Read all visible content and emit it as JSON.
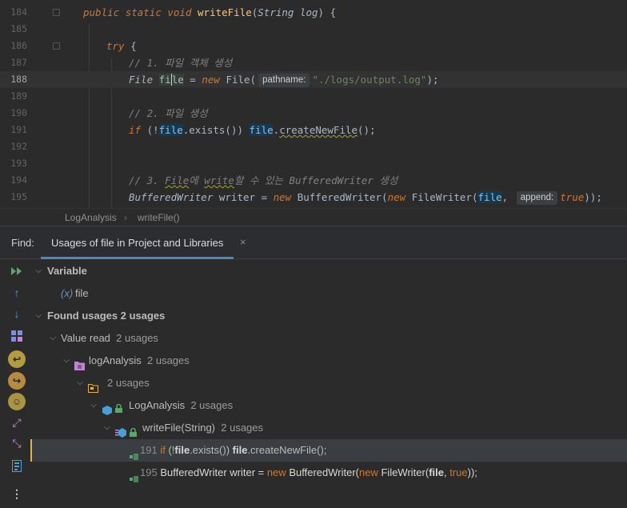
{
  "editor": {
    "lines": [
      {
        "num": "184"
      },
      {
        "num": "185"
      },
      {
        "num": "186"
      },
      {
        "num": "187"
      },
      {
        "num": "188"
      },
      {
        "num": "189"
      },
      {
        "num": "190"
      },
      {
        "num": "191"
      },
      {
        "num": "192"
      },
      {
        "num": "193"
      },
      {
        "num": "194"
      },
      {
        "num": "195"
      }
    ],
    "l184": {
      "public": "public",
      "static": "static",
      "void": "void",
      "name": "writeFile",
      "open": "(",
      "type": "String",
      "param": "log",
      "close": ") {"
    },
    "l186": {
      "try": "try",
      "brace": " {"
    },
    "l187": {
      "comment": "// 1. 파일 객체 생성"
    },
    "l188": {
      "type": "File",
      "var_a": "fi",
      "var_b": "le",
      "eq": " = ",
      "new": "new",
      "ctor": " File(",
      "hint": "pathname:",
      "str": "\"./logs/output.log\"",
      "end": ");"
    },
    "l190": {
      "comment": "// 2. 파일 생성"
    },
    "l191": {
      "if": "if",
      "open": " (!",
      "file1": "file",
      "exists": ".exists()) ",
      "file2": "file",
      "dot": ".",
      "method": "createNewFile",
      "end": "();"
    },
    "l194": {
      "c1": "// 3. ",
      "c2": "File",
      "c3": "에 ",
      "c4": "write",
      "c5": "할 수 있는 BufferedWriter 생성"
    },
    "l195": {
      "type": "BufferedWriter",
      "var": " writer",
      "eq": " = ",
      "new": "new",
      "ctor": " BufferedWriter(",
      "new2": "new",
      "ctor2": " FileWriter(",
      "file": "file",
      "comma": ", ",
      "hint": "append:",
      "true": "true",
      "end": "));"
    }
  },
  "breadcrumb": {
    "class_name": "LogAnalysis",
    "method_name": "writeFile()"
  },
  "find": {
    "label": "Find:",
    "tab_title": "Usages of file in Project and Libraries",
    "tab_close": "×",
    "tree": {
      "variable": "Variable",
      "var_prefix": "(x)",
      "var_name": "file",
      "found": "Found usages",
      "found_count": "2 usages",
      "value_read": "Value read",
      "value_read_count": "2 usages",
      "package": "logAnalysis",
      "package_count": "2 usages",
      "dir_count": "2 usages",
      "class": "LogAnalysis",
      "class_count": "2 usages",
      "method": "writeFile(String)",
      "method_count": "2 usages",
      "usage1": {
        "num": "191",
        "if": "if",
        "p1": " (!",
        "file1": "file",
        "p2": ".exists()) ",
        "file2": "file",
        "p3": ".createNewFile();"
      },
      "usage2": {
        "num": "195",
        "p1": "BufferedWriter writer = ",
        "new": "new",
        "p2": " BufferedWriter(",
        "new2": "new",
        "p3": " FileWriter(",
        "file": "file",
        "p4": ", ",
        "true": "true",
        "p5": "));"
      }
    }
  },
  "colors": {
    "accent": "#4a88c7",
    "keyword": "#cc7832",
    "string": "#6a8759",
    "method": "#ffc66d",
    "comment": "#808080",
    "selection_mark": "#e0b34a"
  }
}
